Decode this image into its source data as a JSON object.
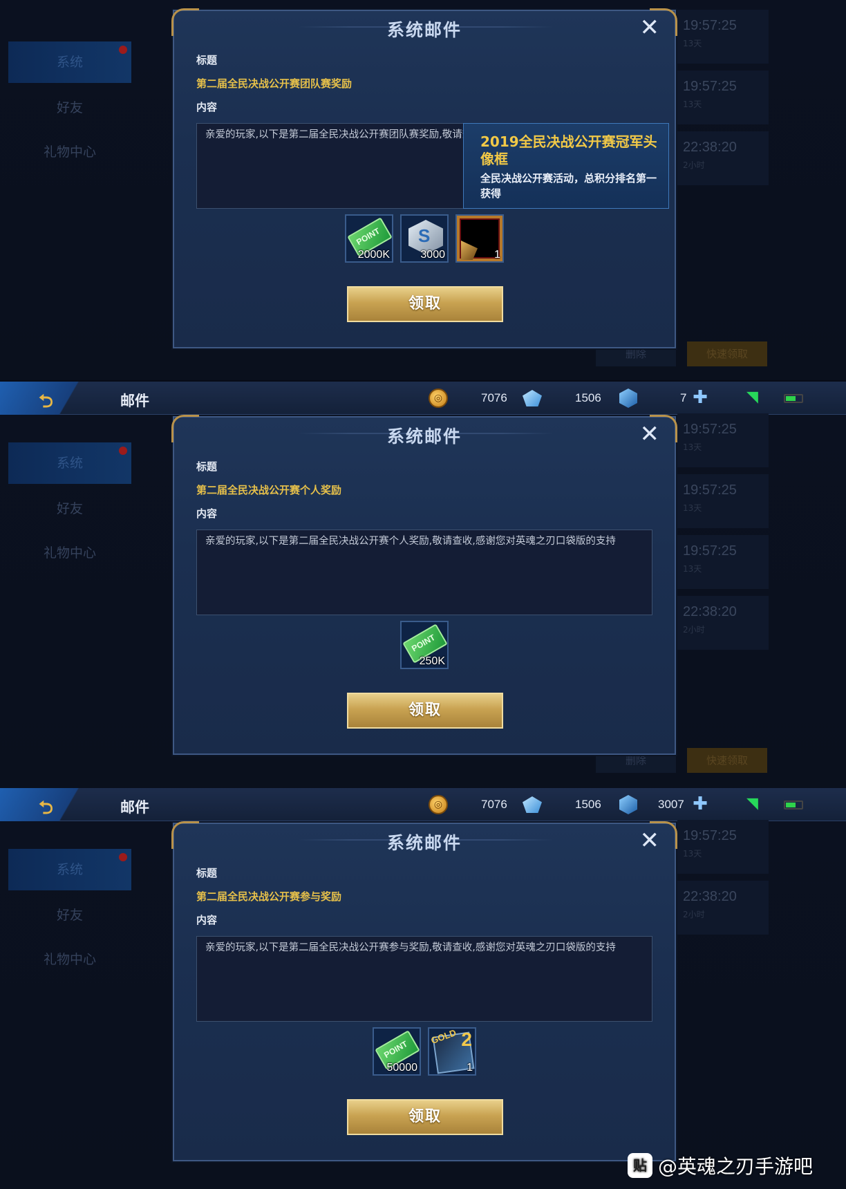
{
  "topbar": {
    "title": "邮件",
    "gold": "7076",
    "diamond": "1506",
    "voucher_panel2": "7",
    "voucher_panel3": "3007"
  },
  "sidebar": {
    "items": [
      "系统",
      "好友",
      "礼物中心"
    ]
  },
  "mail_list": {
    "times": [
      "19:57:25",
      "19:57:25",
      "19:57:25",
      "22:38:20"
    ],
    "ages": [
      "13天",
      "13天",
      "13天",
      "2小时"
    ],
    "delete_label": "删除",
    "quick_claim_label": "快速领取"
  },
  "dialog": {
    "title": "系统邮件",
    "subject_label": "标题",
    "content_label": "内容",
    "claim_label": "领取"
  },
  "mails": [
    {
      "subject": "第二届全民决战公开赛团队赛奖励",
      "content": "亲爱的玩家,以下是第二届全民决战公开赛团队赛奖励,敬请查收,感谢您对英魂之刃口袋版的支持",
      "rewards": [
        {
          "icon": "point-ticket-icon",
          "ticket_text": "POINT",
          "qty": "2000K"
        },
        {
          "icon": "crystal-icon",
          "crystal_text": "S",
          "qty": "3000"
        },
        {
          "icon": "avatar-frame-icon",
          "qty": "1"
        }
      ]
    },
    {
      "subject": "第二届全民决战公开赛个人奖励",
      "content": "亲爱的玩家,以下是第二届全民决战公开赛个人奖励,敬请查收,感谢您对英魂之刃口袋版的支持",
      "rewards": [
        {
          "icon": "point-ticket-icon",
          "ticket_text": "POINT",
          "qty": "250K"
        }
      ]
    },
    {
      "subject": "第二届全民决战公开赛参与奖励",
      "content": "亲爱的玩家,以下是第二届全民决战公开赛参与奖励,敬请查收,感谢您对英魂之刃口袋版的支持",
      "rewards": [
        {
          "icon": "point-ticket-icon",
          "ticket_text": "POINT",
          "qty": "50000"
        },
        {
          "icon": "gold-double-card-icon",
          "card_text": "GOLD",
          "card_num": "2",
          "qty": "1"
        }
      ]
    }
  ],
  "tooltip": {
    "title": "2019全民决战公开赛冠军头像框",
    "description": "全民决战公开赛活动，总积分排名第一获得"
  },
  "watermark": {
    "icon": "贴",
    "text": "@英魂之刃手游吧"
  },
  "colors": {
    "subject": "#e6c04a",
    "claim_button": "#c9a352",
    "tooltip_title": "#f2c947",
    "wifi": "#27d85a"
  }
}
